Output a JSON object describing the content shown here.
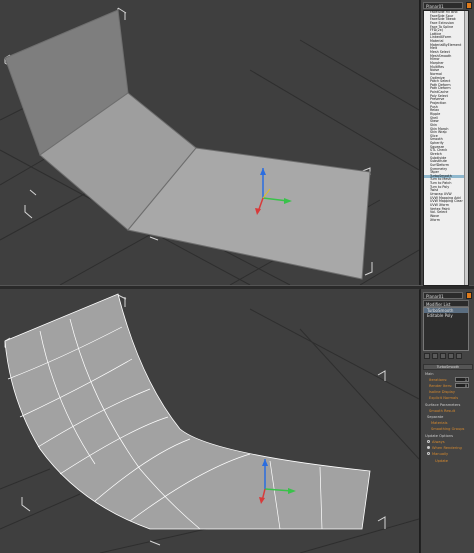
{
  "panel_top": {
    "dropdown_value": "Planar01",
    "modifier_list": [
      "FaceSide Fill Bnd",
      "FaceSide Spur",
      "FaceSide Tweak",
      "Face Extrusion",
      "Face To Spline",
      "FFD(2x)",
      "Lattice",
      "LinkedXForm",
      "Material",
      "MaterialByElement",
      "Melt",
      "Mesh Select",
      "MeshSmooth",
      "Mirror",
      "Morpher",
      "MultiRes",
      "Noise",
      "Normal",
      "Optimize",
      "Patch Select",
      "Path Deform",
      "Path Deform",
      "PointCache",
      "Poly Select",
      "Preserve",
      "Projection",
      "Push",
      "Relax",
      "Ripple",
      "Shell",
      "Skew",
      "Skin",
      "Skin Morph",
      "Skin Wrap",
      "Slice",
      "Smooth",
      "Spherify",
      "Squeeze",
      "STL Check",
      "Stretch",
      "Subdivide",
      "Substitute",
      "SurfDeform",
      "Symmetry",
      "Taper",
      "TurboSmooth",
      "Turn to Mesh",
      "Turn to Patch",
      "Turn to Poly",
      "Twist",
      "Unwrap UVW",
      "UVW Mapping Add",
      "UVW Mapping Clear",
      "UVW Xform",
      "Vertex Paint",
      "Vol. Select",
      "Wave",
      "Xform"
    ],
    "selected_item": "TurboSmooth"
  },
  "panel_bottom": {
    "dropdown_value": "Planar01",
    "modifier_list_label": "Modifier List",
    "stack": [
      "TurboSmooth",
      "Editable Poly"
    ],
    "stack_selected": "TurboSmooth",
    "rollout_title": "TurboSmooth",
    "main_label": "Main",
    "iterations_label": "Iterations:",
    "iterations_value": "1",
    "render_iters_label": "Render Iters:",
    "render_iters_value": "0",
    "isoline_label": "Isoline Display",
    "explicit_label": "Explicit Normals",
    "surface_label": "Surface Parameters",
    "smooth_result_label": "Smooth Result",
    "separate_label": "Separate",
    "materials_label": "Materials",
    "smoothing_groups_label": "Smoothing Groups",
    "update_label": "Update Options",
    "always_label": "Always",
    "when_rendering_label": "When Rendering",
    "manually_label": "Manually",
    "update_button": "Update"
  },
  "colors": {
    "viewport_bg": "#3f3f3f",
    "grid": "#2d2d2d",
    "mesh_fill": "#a5a5a5",
    "mesh_edge": "#ffffff",
    "bbox": "#d6d6d6",
    "accent": "#e07b1a"
  }
}
